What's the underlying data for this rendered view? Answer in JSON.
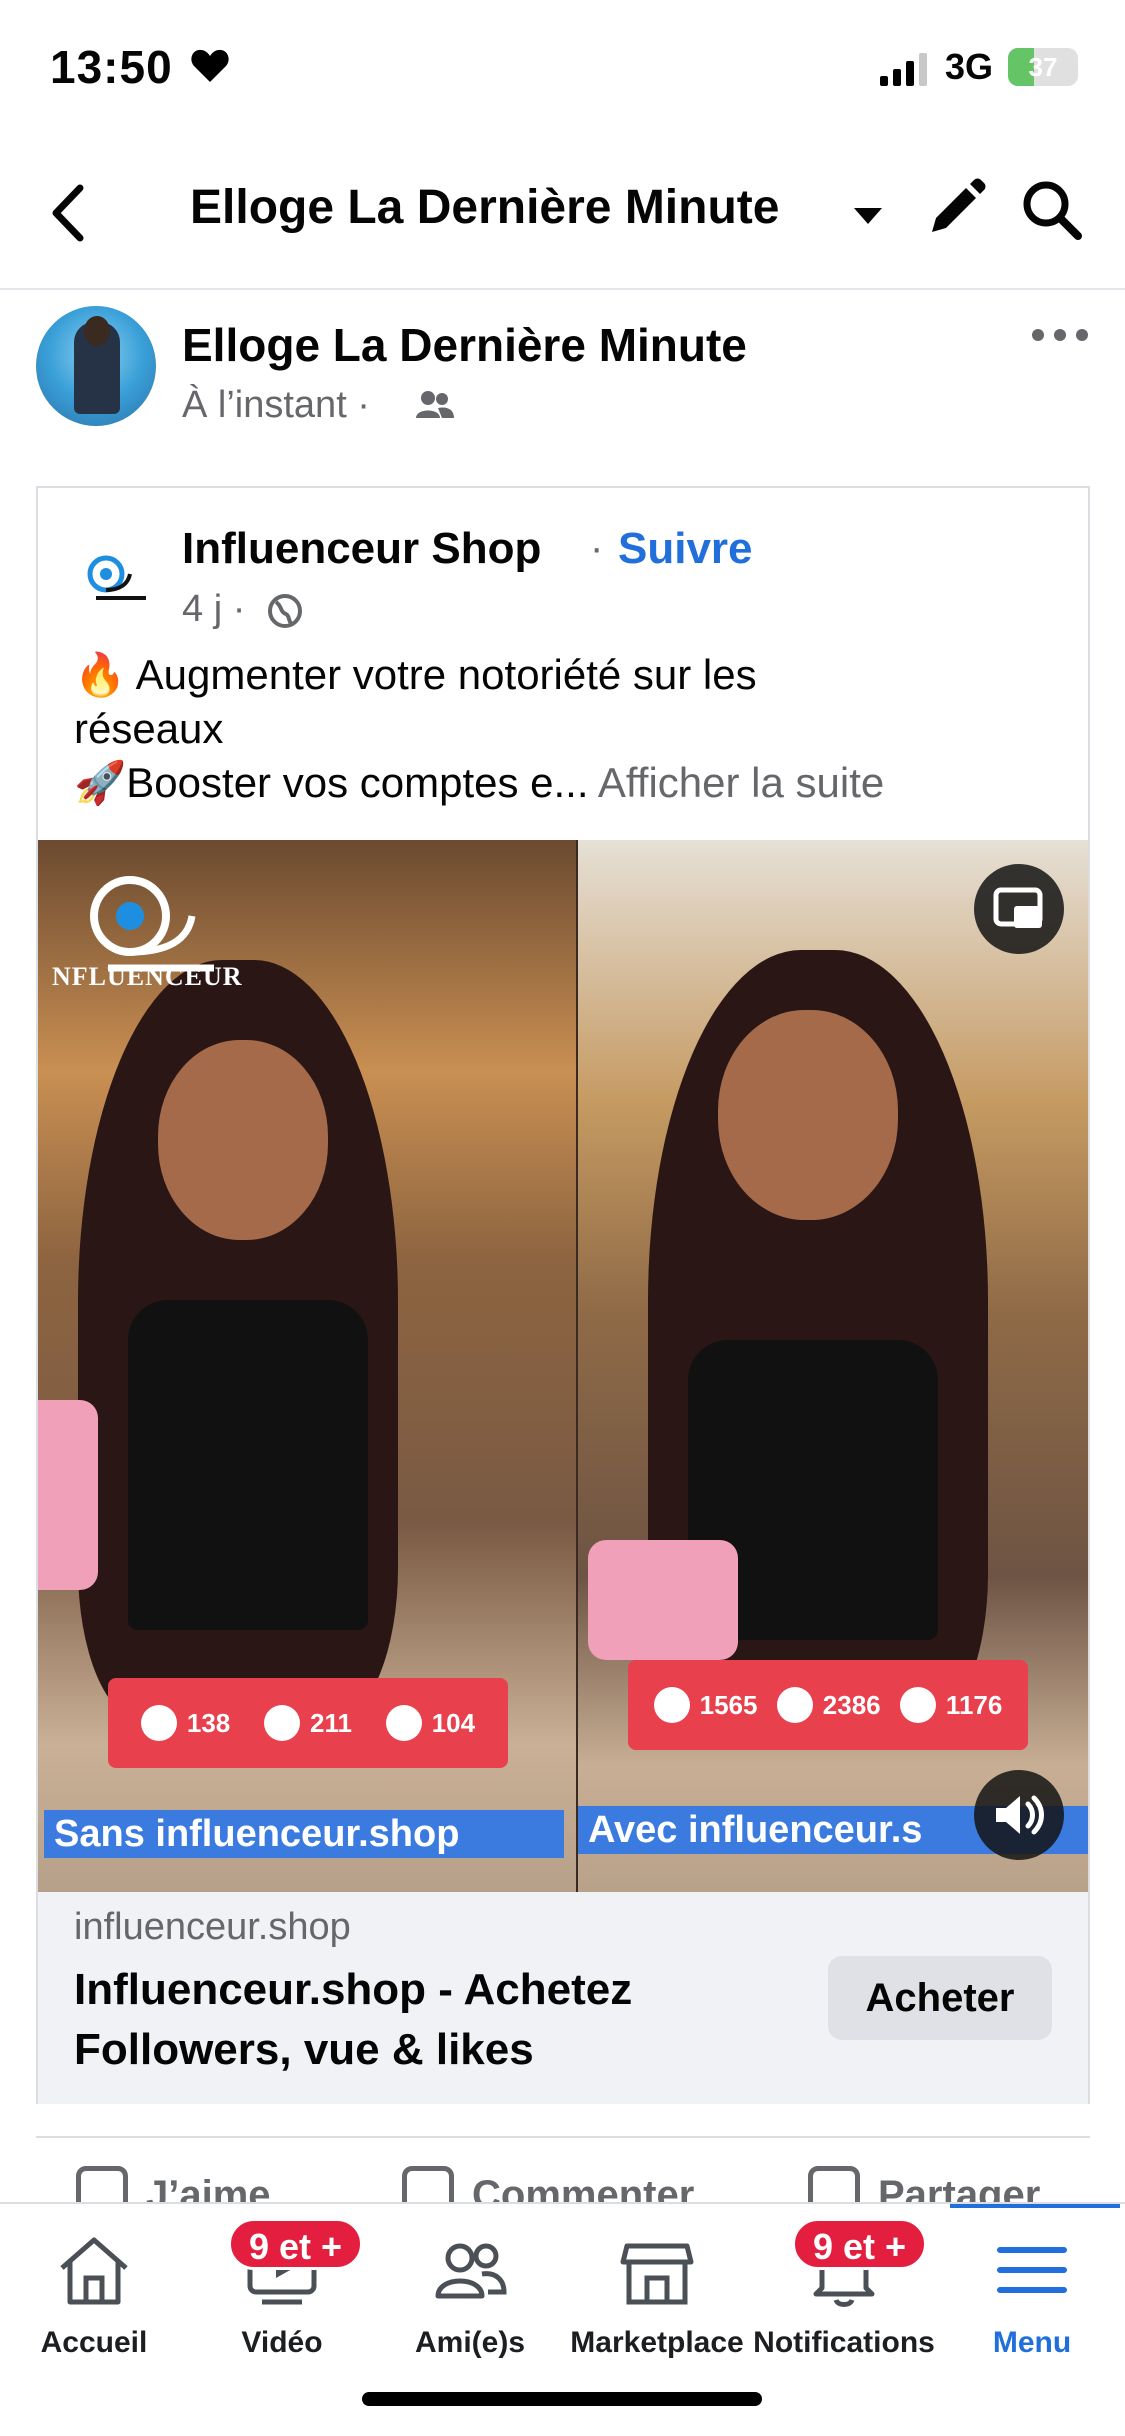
{
  "status_bar": {
    "time": "13:50",
    "network": "3G",
    "battery": "37",
    "battery_level": 0.37
  },
  "header": {
    "title": "Elloge La Dernière Minute"
  },
  "post": {
    "author": "Elloge La Dernière Minute",
    "meta": "À l’instant ·"
  },
  "shared": {
    "shop_name": "Influenceur Shop",
    "separator": "·",
    "follow": "Suivre",
    "meta": "4 j ·",
    "text_line1": "🔥 Augmenter votre notoriété sur les",
    "text_line2": "réseaux",
    "text_line3": "🚀Booster vos comptes e...",
    "see_more": "Afficher la suite"
  },
  "video": {
    "logo_text": "NFLUENCEUR",
    "left": {
      "comments": "138",
      "likes": "211",
      "views": "104",
      "caption": "Sans influenceur.shop"
    },
    "right": {
      "comments": "1565",
      "likes": "2386",
      "views": "1176",
      "caption": "Avec influenceur.s"
    }
  },
  "link": {
    "domain": "influenceur.shop",
    "title_line1": "Influenceur.shop - Achetez",
    "title_line2": "Followers, vue & likes",
    "cta": "Acheter"
  },
  "actions": {
    "like": "J’aime",
    "comment": "Commenter",
    "share": "Partager"
  },
  "tabs": {
    "home": "Accueil",
    "video": "Vidéo",
    "friends": "Ami(e)s",
    "marketplace": "Marketplace",
    "notifications": "Notifications",
    "menu": "Menu",
    "video_badge": "9 et +",
    "notifications_badge": "9 et +"
  },
  "colors": {
    "accent": "#216fdb",
    "badge": "#e41e3f",
    "stats_box": "#e8404c"
  }
}
